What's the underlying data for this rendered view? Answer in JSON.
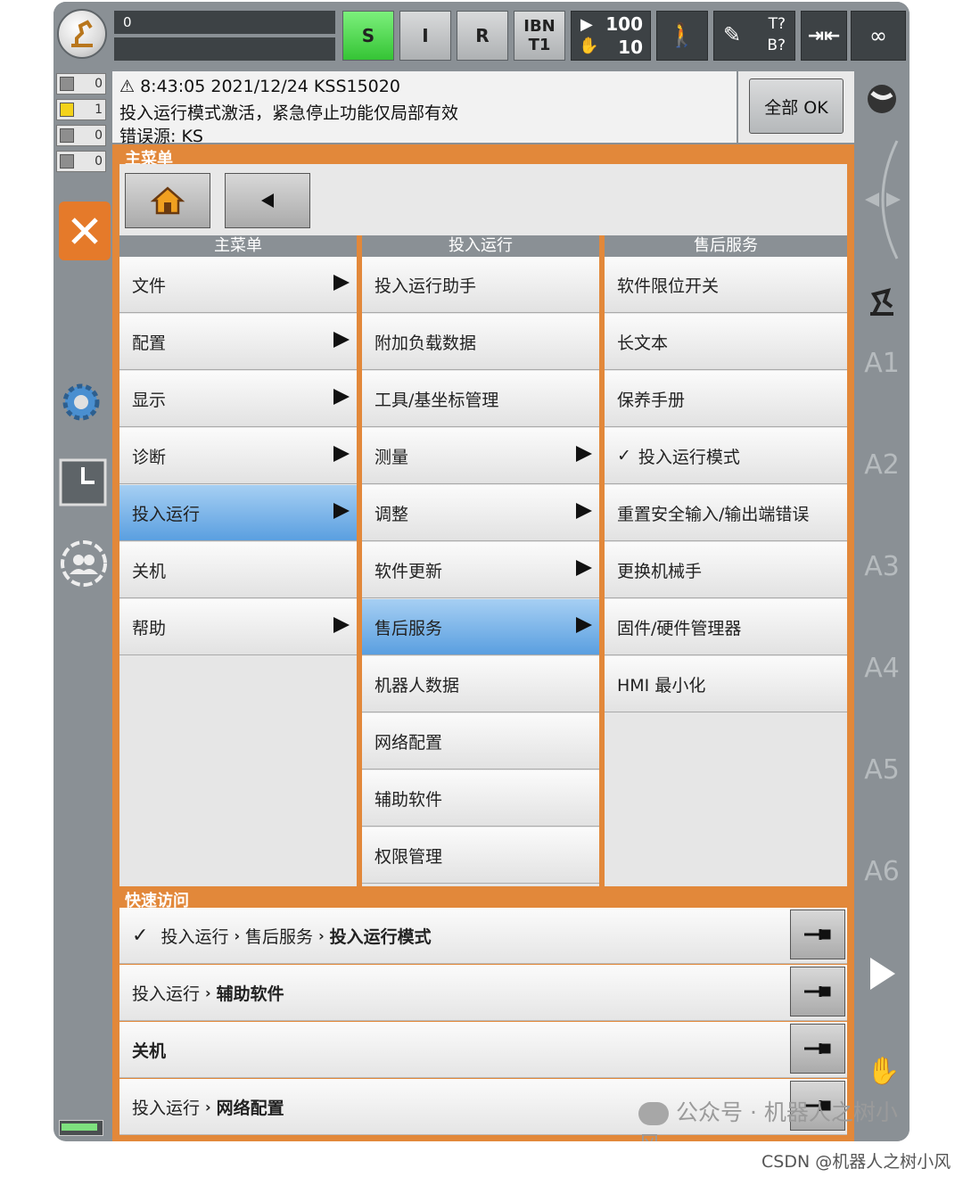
{
  "topbar": {
    "override_value": "0",
    "buttons": [
      "S",
      "I",
      "R"
    ],
    "mode_top": "IBN",
    "mode_bottom": "T1",
    "prog_override": "100",
    "jog_override": "10",
    "tool": "T?",
    "base": "B?",
    "infinity": "∞"
  },
  "status_counts": [
    "0",
    "1",
    "0",
    "0"
  ],
  "message": {
    "time": "8:43:05 2021/12/24 KSS15020",
    "text": "投入运行模式激活，紧急停止功能仅局部有效",
    "source": "错误源: KS",
    "ok_button": "全部 OK"
  },
  "main_title": "主菜单",
  "columns": [
    {
      "header": "主菜单",
      "items": [
        {
          "label": "文件",
          "arrow": true
        },
        {
          "label": "配置",
          "arrow": true
        },
        {
          "label": "显示",
          "arrow": true
        },
        {
          "label": "诊断",
          "arrow": true
        },
        {
          "label": "投入运行",
          "arrow": true,
          "selected": true
        },
        {
          "label": "关机",
          "arrow": false
        },
        {
          "label": "帮助",
          "arrow": true
        }
      ]
    },
    {
      "header": "投入运行",
      "items": [
        {
          "label": "投入运行助手",
          "arrow": false
        },
        {
          "label": "附加负载数据",
          "arrow": false
        },
        {
          "label": "工具/基坐标管理",
          "arrow": false
        },
        {
          "label": "测量",
          "arrow": true
        },
        {
          "label": "调整",
          "arrow": true
        },
        {
          "label": "软件更新",
          "arrow": true
        },
        {
          "label": "售后服务",
          "arrow": true,
          "selected": true
        },
        {
          "label": "机器人数据",
          "arrow": false
        },
        {
          "label": "网络配置",
          "arrow": false
        },
        {
          "label": "辅助软件",
          "arrow": false
        },
        {
          "label": "权限管理",
          "arrow": false
        }
      ]
    },
    {
      "header": "售后服务",
      "items": [
        {
          "label": "软件限位开关",
          "arrow": false
        },
        {
          "label": "长文本",
          "arrow": false
        },
        {
          "label": "保养手册",
          "arrow": false
        },
        {
          "label": "投入运行模式",
          "arrow": false,
          "checked": true
        },
        {
          "label": "重置安全输入/输出端错误",
          "arrow": false
        },
        {
          "label": "更换机械手",
          "arrow": false
        },
        {
          "label": "固件/硬件管理器",
          "arrow": false
        },
        {
          "label": "HMI 最小化",
          "arrow": false
        }
      ]
    }
  ],
  "quick_access": {
    "title": "快速访问",
    "items": [
      {
        "checked": true,
        "path": [
          "投入运行",
          "售后服务"
        ],
        "target": "投入运行模式"
      },
      {
        "checked": false,
        "path": [
          "投入运行"
        ],
        "target": "辅助软件"
      },
      {
        "checked": false,
        "path": [],
        "target": "关机"
      },
      {
        "checked": false,
        "path": [
          "投入运行"
        ],
        "target": "网络配置"
      }
    ]
  },
  "axes": [
    "A1",
    "A2",
    "A3",
    "A4",
    "A5",
    "A6"
  ],
  "watermark": "公众号 · 机器人之树小风",
  "csdn": "CSDN @机器人之树小风",
  "colors": {
    "accent_orange": "#e2883a",
    "selected_blue": "#5a9fe0",
    "frame_gray": "#8a9095"
  }
}
